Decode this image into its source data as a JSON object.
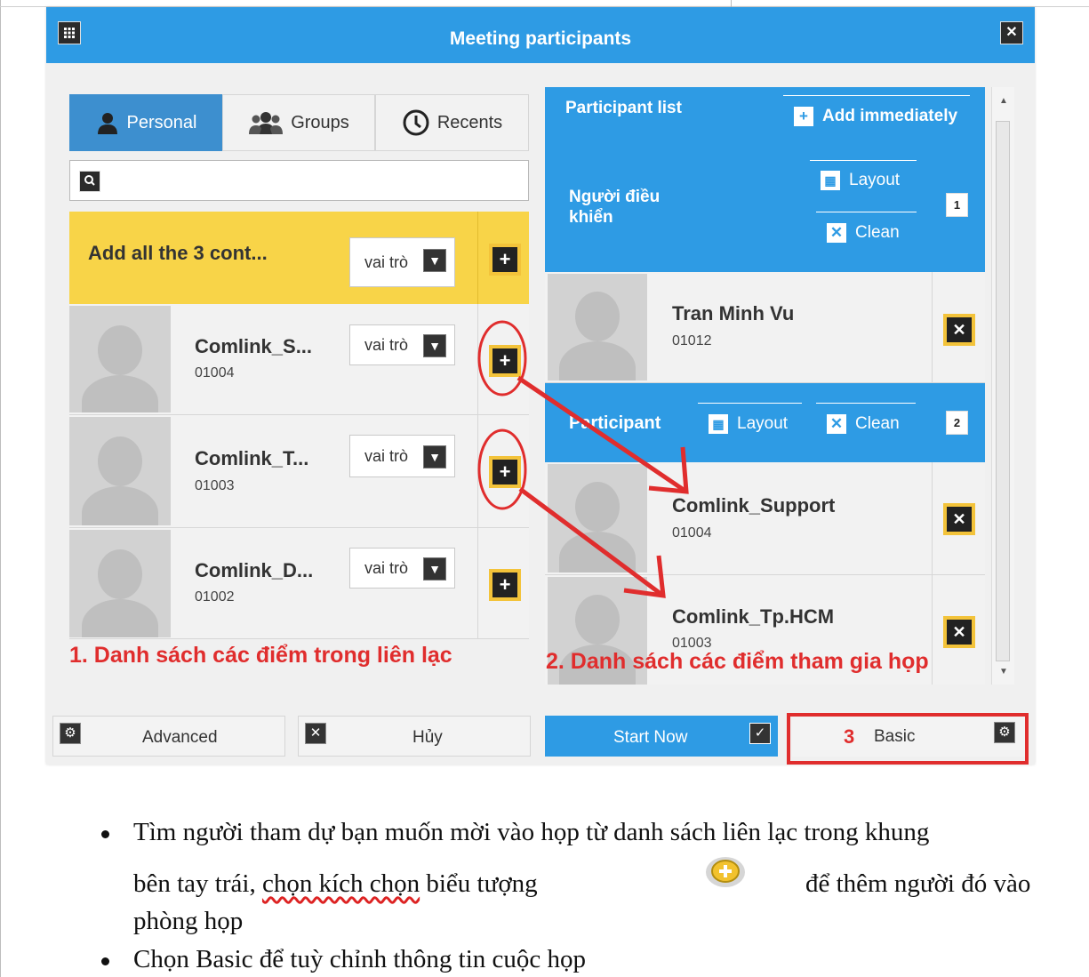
{
  "dialog": {
    "title": "Meeting participants",
    "grid_icon": "grid-icon",
    "close_icon": "close-icon"
  },
  "tabs": [
    {
      "label": "Personal",
      "icon": "person-icon"
    },
    {
      "label": "Groups",
      "icon": "group-icon"
    },
    {
      "label": "Recents",
      "icon": "clock-icon"
    }
  ],
  "search": {
    "placeholder": "",
    "icon": "search-icon"
  },
  "contacts": {
    "add_all_label": "Add all the 3 cont...",
    "role_label": "vai trò",
    "items": [
      {
        "name": "Comlink_S...",
        "code": "01004"
      },
      {
        "name": "Comlink_T...",
        "code": "01003"
      },
      {
        "name": "Comlink_D...",
        "code": "01002"
      }
    ]
  },
  "participant_panel": {
    "list_title": "Participant list",
    "add_immediately": "Add immediately",
    "host_label": "Người điều khiển",
    "layout_label": "Layout",
    "clean_label": "Clean",
    "host_count": "1",
    "host": {
      "name": "Tran Minh Vu",
      "code": "01012"
    },
    "participant_label": "Participant",
    "participant_count": "2",
    "participants": [
      {
        "name": "Comlink_Support",
        "code": "01004"
      },
      {
        "name": "Comlink_Tp.HCM",
        "code": "01003"
      }
    ]
  },
  "annotations": {
    "left": "1. Danh sách các điểm trong liên lạc",
    "right": "2. Danh sách các điểm tham gia họp",
    "basic_number": "3"
  },
  "footer": {
    "advanced": "Advanced",
    "cancel": "Hủy",
    "start_now": "Start Now",
    "basic": "Basic"
  },
  "instructions": {
    "b1_part1": "Tìm người tham dự bạn muốn mời vào họp từ danh sách liên lạc trong khung",
    "b1_part2a": "bên tay trái, ",
    "b1_part2b": "chọn kích chọn",
    "b1_part2c": " biểu tượng",
    "b1_part2d": "để thêm người đó vào",
    "b1_part3": "phòng họp",
    "b2": "Chọn Basic để tuỳ chỉnh thông tin cuộc họp"
  },
  "colors": {
    "accent": "#2e9be4",
    "highlight": "#f8d448",
    "annotation": "#e02d2d"
  }
}
